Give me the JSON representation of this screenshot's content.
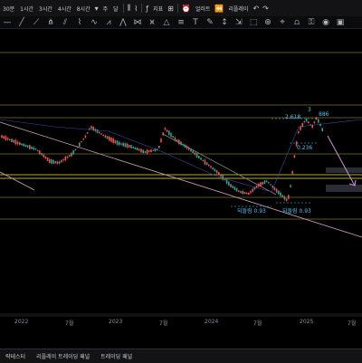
{
  "toolbar": {
    "intervals": [
      "30분",
      "1시간",
      "3시간",
      "4시간",
      "8시간"
    ],
    "period_label": "주",
    "month_label": "달",
    "indicators_label": "지표",
    "alert_label": "얼러트",
    "replay_label": "리플레이"
  },
  "xaxis": {
    "ticks": [
      "2022",
      "7월",
      "2023",
      "7월",
      "2024",
      "7월",
      "2025",
      "7월"
    ]
  },
  "annotations": {
    "fib_high": "2.618",
    "fib_mid": "0.236",
    "wave_top": "3",
    "wave_top_right": "886",
    "retest_left": "되돌림 0.93",
    "retest_right": "되돌림 0.93"
  },
  "bottom_tabs": [
    "략테스터",
    "리플레이 트레이딩 패널",
    "트레이딩 패널"
  ],
  "colors": {
    "up_candle": "#26a69a",
    "down_candle": "#ef5350",
    "support_line": "#c9b84a",
    "trend_line": "#d4a0c0",
    "label_blue": "#4fc3f7",
    "arrow": "#ce93d8"
  }
}
